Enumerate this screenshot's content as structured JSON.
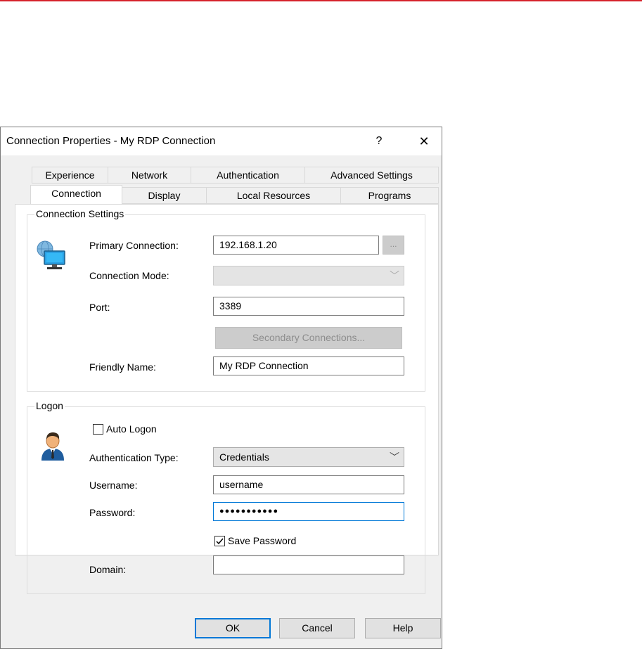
{
  "window": {
    "title": "Connection Properties - My RDP Connection",
    "help_glyph": "?",
    "close_glyph": "✕"
  },
  "tabs": {
    "row1": [
      "Experience",
      "Network",
      "Authentication",
      "Advanced Settings"
    ],
    "row2": [
      "Connection",
      "Display",
      "Local Resources",
      "Programs"
    ],
    "active": "Connection"
  },
  "connection_settings": {
    "legend": "Connection Settings",
    "icon": "network-computer-icon",
    "primary_connection_label": "Primary Connection:",
    "primary_connection_value": "192.168.1.20",
    "browse_label": "...",
    "connection_mode_label": "Connection Mode:",
    "connection_mode_value": "",
    "port_label": "Port:",
    "port_value": "3389",
    "secondary_connections_label": "Secondary Connections...",
    "friendly_name_label": "Friendly Name:",
    "friendly_name_value": "My RDP Connection"
  },
  "logon": {
    "legend": "Logon",
    "icon": "user-icon",
    "auto_logon_label": "Auto Logon",
    "auto_logon_checked": false,
    "auth_type_label": "Authentication Type:",
    "auth_type_value": "Credentials",
    "username_label": "Username:",
    "username_value": "username",
    "password_label": "Password:",
    "password_value": "●●●●●●●●●●●",
    "save_password_label": "Save Password",
    "save_password_checked": true,
    "domain_label": "Domain:",
    "domain_value": ""
  },
  "footer": {
    "ok_label": "OK",
    "cancel_label": "Cancel",
    "help_label": "Help"
  },
  "colors": {
    "accent": "#0078d7",
    "top_rule": "#d6232b"
  }
}
